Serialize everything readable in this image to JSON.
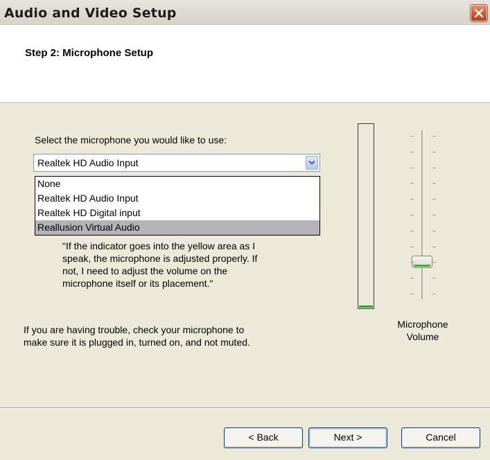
{
  "window": {
    "title": "Audio and Video Setup",
    "close_icon": "close-icon"
  },
  "header": {
    "step_title": "Step 2: Microphone Setup"
  },
  "mic": {
    "select_label": "Select the microphone you would like to use:",
    "selected": "Realtek HD Audio Input",
    "options": [
      "None",
      "Realtek HD Audio Input",
      "Realtek HD Digital input",
      "Reallusion Virtual Audio"
    ],
    "highlighted_index": 3
  },
  "quote_lines": [
    "\"If the indicator goes into the yellow area as I",
    "speak, the microphone is adjusted properly.  If",
    "not, I need to adjust the volume on the",
    "microphone itself or its placement.\""
  ],
  "help_lines": [
    "If you are having trouble, check your microphone to",
    "make sure it is plugged in, turned on, and not muted."
  ],
  "level_meter": {
    "level_fraction": 0.01,
    "fill_color": "#27a427"
  },
  "volume": {
    "label_lines": [
      "Microphone",
      "Volume"
    ],
    "value_fraction": 0.2
  },
  "buttons": {
    "back": "< Back",
    "next": "Next >",
    "cancel": "Cancel"
  }
}
